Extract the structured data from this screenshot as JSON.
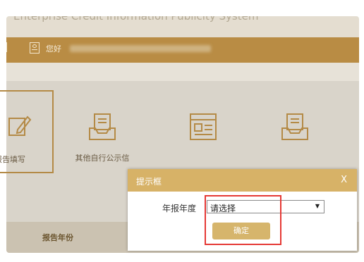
{
  "header": {
    "system_title": "Enterprise Credit Information Publicity System",
    "greeting": "您好"
  },
  "cards": [
    {
      "label": "报告填写",
      "icon": "pencil-edit-icon",
      "selected": true
    },
    {
      "label": "其他自行公示信",
      "icon": "document-tray-icon",
      "selected": false
    },
    {
      "label": "",
      "icon": "form-window-icon",
      "selected": false
    },
    {
      "label": "",
      "icon": "document-tray-icon",
      "selected": false
    }
  ],
  "table": {
    "col_report_year": "报告年份"
  },
  "dialog": {
    "title": "提示框",
    "close_label": "X",
    "field_label": "年报年度",
    "select_value": "请选择",
    "confirm_label": "确定"
  },
  "colors": {
    "nav_gold": "#b98c44",
    "dialog_header": "#d7b267",
    "button_gold": "#d6b56c",
    "highlight_red": "#e53935"
  }
}
